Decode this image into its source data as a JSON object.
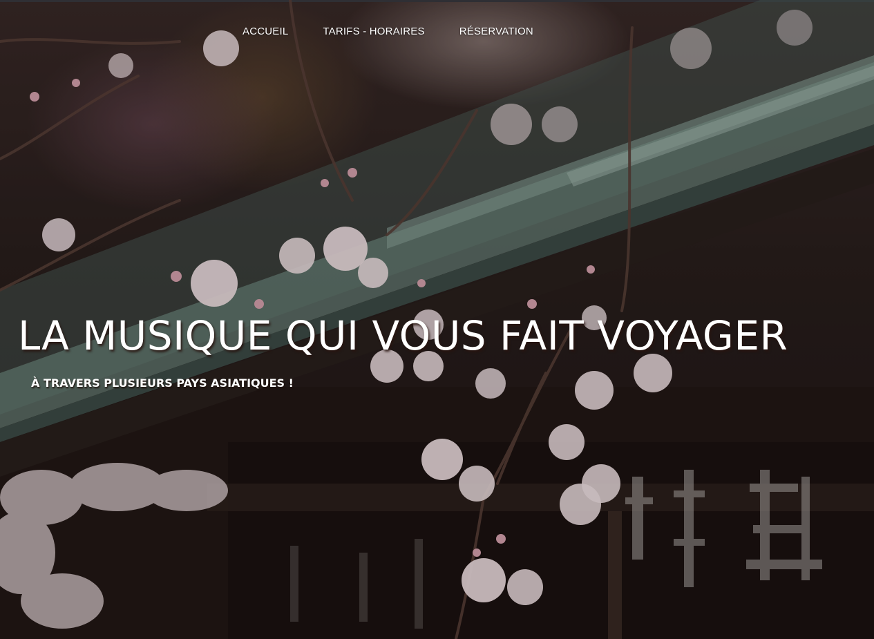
{
  "nav": {
    "items": [
      {
        "label": "ACCUEIL"
      },
      {
        "label": "TARIFS - HORAIRES"
      },
      {
        "label": "RÉSERVATION"
      }
    ]
  },
  "hero": {
    "title": "LA MUSIQUE QUI VOUS FAIT VOYAGER",
    "subtitle": "À TRAVERS PLUSIEURS PAYS ASIATIQUES !",
    "background_image": "cherry-blossoms-temple-photo"
  },
  "colors": {
    "text": "#ffffff",
    "roof": "#5f7a70",
    "wood": "#2b1e1a",
    "blossom": "#f2e4e6"
  }
}
